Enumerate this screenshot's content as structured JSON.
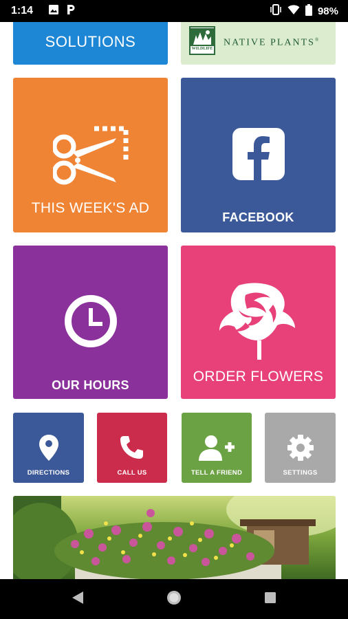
{
  "status_bar": {
    "time": "1:14",
    "battery": "98%",
    "notification_icons": [
      "image-icon",
      "parking-icon"
    ],
    "system_icons": [
      "vibrate-icon",
      "wifi-icon",
      "battery-icon"
    ]
  },
  "tiles": {
    "solutions": {
      "label": "SOLUTIONS",
      "color": "#1d86d5"
    },
    "native_plants": {
      "label": "NATIVE PLANTS",
      "trademark": "®",
      "logo_text": "WILDLIFE",
      "color": "#dcecce"
    },
    "weekly_ad": {
      "label": "THIS WEEK'S AD",
      "icon": "scissors-coupon-icon",
      "color": "#f08435"
    },
    "facebook": {
      "label": "FACEBOOK",
      "icon": "facebook-icon",
      "color": "#3b5998"
    },
    "our_hours": {
      "label": "OUR HOURS",
      "icon": "clock-icon",
      "color": "#8a319b"
    },
    "order_flowers": {
      "label": "ORDER FLOWERS",
      "icon": "rose-icon",
      "color": "#e8417a"
    },
    "directions": {
      "label": "DIRECTIONS",
      "icon": "location-pin-icon",
      "color": "#3b5998"
    },
    "call_us": {
      "label": "CALL US",
      "icon": "phone-icon",
      "color": "#cc2c4c"
    },
    "tell_a_friend": {
      "label": "TELL A FRIEND",
      "icon": "add-person-icon",
      "color": "#6ba244"
    },
    "settings": {
      "label": "SETTINGS",
      "icon": "gear-icon",
      "color": "#a9a9a9"
    }
  },
  "banner": {
    "subject": "hanging-flower-basket-photo"
  },
  "nav_bar": {
    "buttons": [
      "back-icon",
      "home-icon",
      "recents-icon"
    ]
  }
}
